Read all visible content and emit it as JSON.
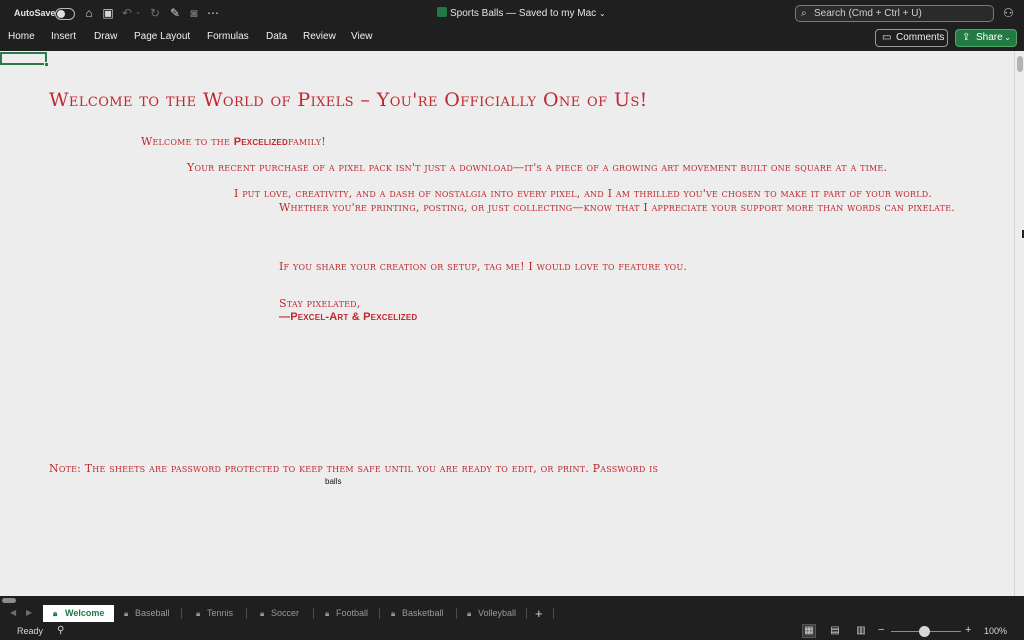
{
  "titlebar": {
    "autosave_label": "AutoSave",
    "document_title": "Sports Balls — Saved to my Mac",
    "search_placeholder": "Search (Cmd + Ctrl + U)"
  },
  "ribbon": {
    "tabs": [
      "Home",
      "Insert",
      "Draw",
      "Page Layout",
      "Formulas",
      "Data",
      "Review",
      "View"
    ],
    "comments_label": "Comments",
    "share_label": "Share"
  },
  "sheet": {
    "heading": "Welcome to the World of Pixels – You're Officially One of Us!",
    "welcome_prefix": "Welcome to the ",
    "welcome_brand": "Pexcelized",
    "welcome_suffix": "family!",
    "line_purchase": "Your recent purchase of a pixel pack isn't just a download—it's a piece of a growing art movement built one square at a time.",
    "line_love": "I put love, creativity, and a dash of nostalgia into every pixel, and I am thrilled you've chosen to make it part of your world.",
    "line_printing": "Whether you're printing, posting, or just collecting—know that I appreciate your support more than words can pixelate.",
    "line_share": "If you share your creation or setup, tag me! I would love to feature you.",
    "signoff": "Stay pixelated,",
    "signature": "—Pexcel-Art & Pexcelized",
    "note": "Note: The sheets are password protected to keep them safe until you are ready to edit, or print.  Password is",
    "password": "balls"
  },
  "sheet_tabs": [
    {
      "label": "Welcome",
      "active": true
    },
    {
      "label": "Baseball",
      "active": false
    },
    {
      "label": "Tennis",
      "active": false
    },
    {
      "label": "Soccer",
      "active": false
    },
    {
      "label": "Football",
      "active": false
    },
    {
      "label": "Basketball",
      "active": false
    },
    {
      "label": "Volleyball",
      "active": false
    }
  ],
  "statusbar": {
    "ready_label": "Ready",
    "zoom_level": "100%"
  },
  "colors": {
    "accent_text": "#c0282e",
    "brand_green": "#1f7a45"
  },
  "icons": [
    "home-icon",
    "save-icon",
    "undo-icon",
    "redo-icon",
    "edit-icon",
    "camera-icon",
    "more-icon",
    "search-icon",
    "share-person-icon",
    "comment-icon",
    "share-icon",
    "lock-icon",
    "add-sheet-icon",
    "accessibility-icon",
    "normal-view-icon",
    "page-layout-view-icon",
    "page-break-view-icon"
  ]
}
